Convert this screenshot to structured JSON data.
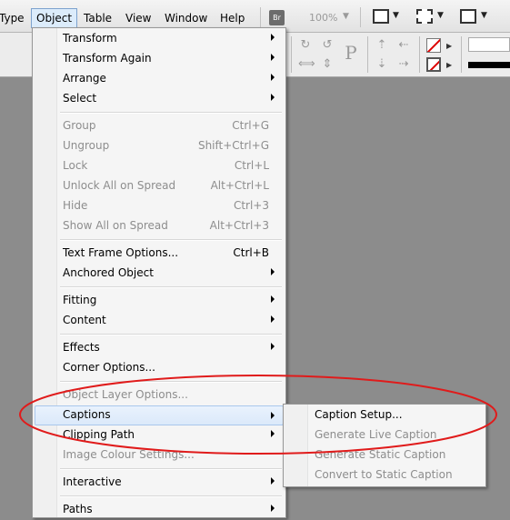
{
  "menubar": {
    "items": [
      {
        "label": "Type"
      },
      {
        "label": "Object"
      },
      {
        "label": "Table"
      },
      {
        "label": "View"
      },
      {
        "label": "Window"
      },
      {
        "label": "Help"
      }
    ],
    "bridge_label": "Br",
    "zoom": "100%"
  },
  "object_menu": {
    "items": [
      {
        "label": "Transform",
        "shortcut": "",
        "submenu": true,
        "enabled": true
      },
      {
        "label": "Transform Again",
        "shortcut": "",
        "submenu": true,
        "enabled": true
      },
      {
        "label": "Arrange",
        "shortcut": "",
        "submenu": true,
        "enabled": true
      },
      {
        "label": "Select",
        "shortcut": "",
        "submenu": true,
        "enabled": true
      },
      {
        "label": "Group",
        "shortcut": "Ctrl+G",
        "submenu": false,
        "enabled": false
      },
      {
        "label": "Ungroup",
        "shortcut": "Shift+Ctrl+G",
        "submenu": false,
        "enabled": false
      },
      {
        "label": "Lock",
        "shortcut": "Ctrl+L",
        "submenu": false,
        "enabled": false
      },
      {
        "label": "Unlock All on Spread",
        "shortcut": "Alt+Ctrl+L",
        "submenu": false,
        "enabled": false
      },
      {
        "label": "Hide",
        "shortcut": "Ctrl+3",
        "submenu": false,
        "enabled": false
      },
      {
        "label": "Show All on Spread",
        "shortcut": "Alt+Ctrl+3",
        "submenu": false,
        "enabled": false
      },
      {
        "label": "Text Frame Options...",
        "shortcut": "Ctrl+B",
        "submenu": false,
        "enabled": true
      },
      {
        "label": "Anchored Object",
        "shortcut": "",
        "submenu": true,
        "enabled": true
      },
      {
        "label": "Fitting",
        "shortcut": "",
        "submenu": true,
        "enabled": true
      },
      {
        "label": "Content",
        "shortcut": "",
        "submenu": true,
        "enabled": true
      },
      {
        "label": "Effects",
        "shortcut": "",
        "submenu": true,
        "enabled": true
      },
      {
        "label": "Corner Options...",
        "shortcut": "",
        "submenu": false,
        "enabled": true
      },
      {
        "label": "Object Layer Options...",
        "shortcut": "",
        "submenu": false,
        "enabled": false
      },
      {
        "label": "Captions",
        "shortcut": "",
        "submenu": true,
        "enabled": true,
        "highlighted": true
      },
      {
        "label": "Clipping Path",
        "shortcut": "",
        "submenu": true,
        "enabled": true
      },
      {
        "label": "Image Colour Settings...",
        "shortcut": "",
        "submenu": false,
        "enabled": false
      },
      {
        "label": "Interactive",
        "shortcut": "",
        "submenu": true,
        "enabled": true
      },
      {
        "label": "Paths",
        "shortcut": "",
        "submenu": true,
        "enabled": true
      }
    ]
  },
  "captions_submenu": {
    "items": [
      {
        "label": "Caption Setup...",
        "enabled": true
      },
      {
        "label": "Generate Live Caption",
        "enabled": false
      },
      {
        "label": "Generate Static Caption",
        "enabled": false
      },
      {
        "label": "Convert to Static Caption",
        "enabled": false
      }
    ]
  },
  "colors": {
    "annotation": "#e01b1b",
    "highlight": "#dbe9fa",
    "disabled_text": "#8d8d8d",
    "workspace": "#8c8c8c"
  }
}
